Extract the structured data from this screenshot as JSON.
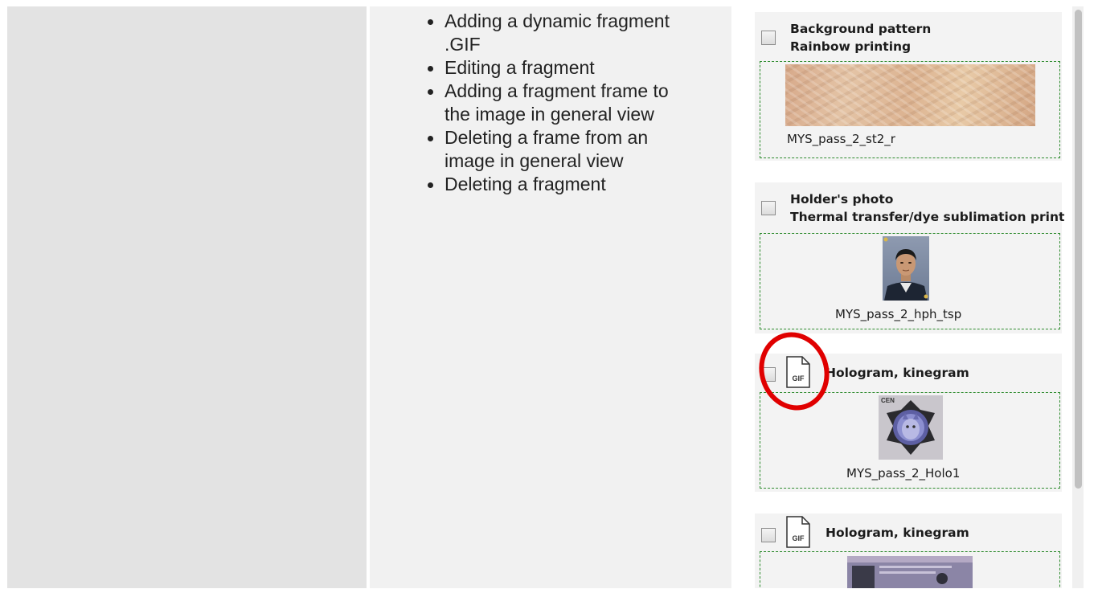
{
  "nav": {
    "items": [
      {
        "label": "Adding a dynamic fragment .GIF"
      },
      {
        "label": "Editing a fragment"
      },
      {
        "label": "Adding a fragment frame to the image in general view"
      },
      {
        "label": "Deleting a frame from an image in general view"
      },
      {
        "label": "Deleting a fragment"
      }
    ]
  },
  "cards": [
    {
      "title_line1": "Background pattern",
      "title_line2": "Rainbow printing",
      "fragment_name": "MYS_pass_2_st2_r"
    },
    {
      "title_line1": "Holder's photo",
      "title_line2": "Thermal transfer/dye sublimation print",
      "fragment_name": "MYS_pass_2_hph_tsp"
    },
    {
      "title": "Hologram, kinegram",
      "icon": "gif-file-icon",
      "fragment_name": "MYS_pass_2_Holo1",
      "thumb_text": "CEN"
    },
    {
      "title": "Hologram, kinegram",
      "icon": "gif-file-icon"
    }
  ],
  "gif_label": "GIF",
  "colors": {
    "dash_border": "#2e8b2e",
    "highlight": "#e00000"
  }
}
